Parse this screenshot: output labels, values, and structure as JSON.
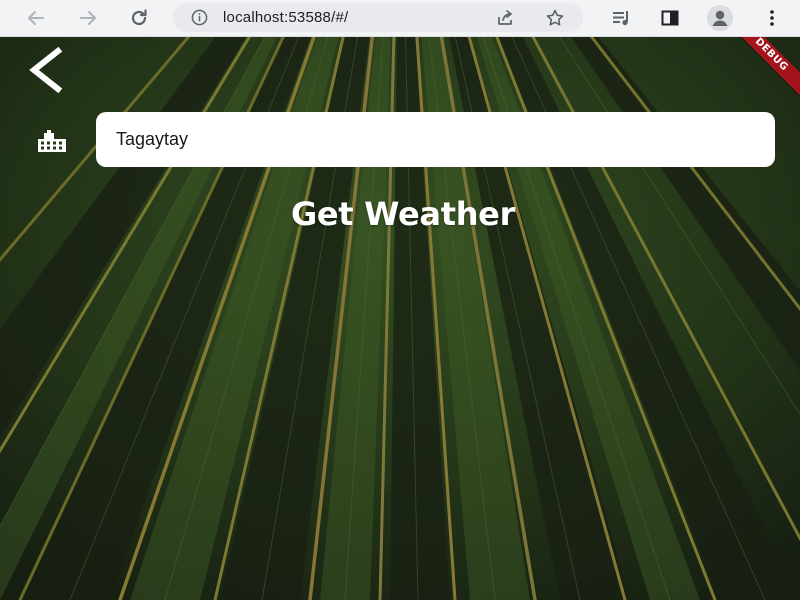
{
  "browser": {
    "url": "localhost:53588/#/",
    "icons": {
      "back": "arrow-left-icon",
      "forward": "arrow-right-icon",
      "reload": "reload-icon",
      "site_info": "info-icon",
      "share": "share-icon",
      "bookmark": "star-icon",
      "media": "media-queue-icon",
      "side_panel": "side-panel-icon",
      "profile": "profile-avatar-icon",
      "menu": "kebab-menu-icon"
    }
  },
  "app": {
    "debug_label": "DEBUG",
    "city_input_value": "Tagaytay",
    "get_weather_label": "Get Weather",
    "icons": {
      "back": "chevron-left-icon",
      "city": "city-buildings-icon"
    },
    "colors": {
      "debug_banner": "#a3141c",
      "input_background": "#ffffff",
      "text_primary": "#ffffff"
    }
  }
}
